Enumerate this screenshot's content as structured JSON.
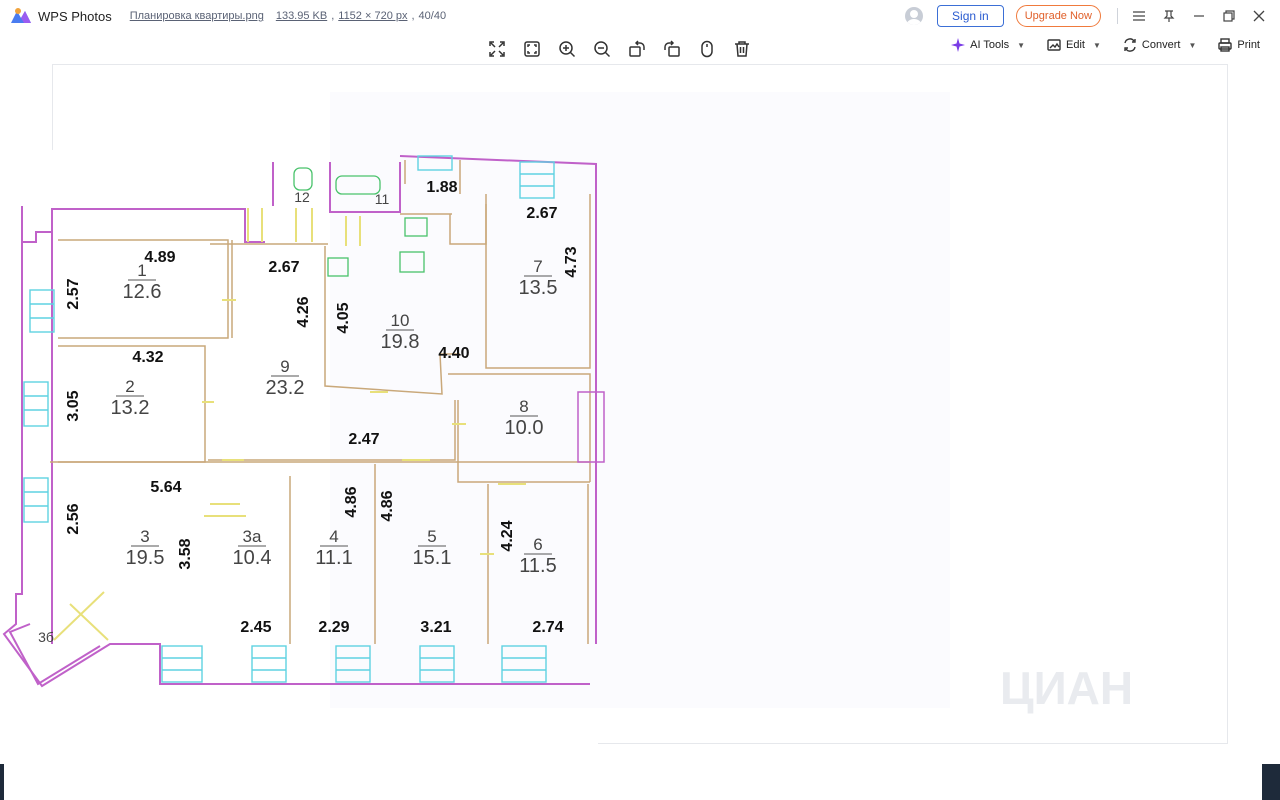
{
  "app": {
    "name": "WPS Photos"
  },
  "file": {
    "name": "Планировка квартиры.png",
    "size": "133.95 KB",
    "dimensions": "1152 × 720 px",
    "index": "40/40"
  },
  "account": {
    "sign_in": "Sign in",
    "upgrade": "Upgrade Now"
  },
  "toolbar": {
    "center_tools": [
      "fit-window-icon",
      "actual-size-icon",
      "zoom-in-icon",
      "zoom-out-icon",
      "rotate-left-icon",
      "rotate-right-icon",
      "mouse-icon",
      "delete-icon"
    ],
    "ai_tools": "AI Tools",
    "edit": "Edit",
    "convert": "Convert",
    "print": "Print"
  },
  "floorplan": {
    "rooms": [
      {
        "id": "1",
        "area": "12.6"
      },
      {
        "id": "2",
        "area": "13.2"
      },
      {
        "id": "3",
        "area": "19.5"
      },
      {
        "id": "3a",
        "area": "10.4"
      },
      {
        "id": "3б",
        "area": ""
      },
      {
        "id": "4",
        "area": "11.1"
      },
      {
        "id": "5",
        "area": "15.1"
      },
      {
        "id": "6",
        "area": "11.5"
      },
      {
        "id": "7",
        "area": "13.5"
      },
      {
        "id": "8",
        "area": "10.0"
      },
      {
        "id": "9",
        "area": "23.2"
      },
      {
        "id": "10",
        "area": "19.8"
      },
      {
        "id": "11",
        "area": ""
      },
      {
        "id": "12",
        "area": ""
      }
    ],
    "dimensions": [
      "4.89",
      "2.57",
      "4.32",
      "3.05",
      "5.64",
      "2.56",
      "3.58",
      "2.45",
      "2.29",
      "4.86",
      "4.86",
      "3.21",
      "2.74",
      "4.24",
      "2.67",
      "4.26",
      "4.05",
      "4.40",
      "2.47",
      "1.88",
      "2.67",
      "4.73"
    ],
    "watermark": "ЦИАН"
  },
  "colors": {
    "wall": "#c061c9",
    "window": "#5fd2e2",
    "door": "#e8e07a",
    "accent": "#3b6fd6",
    "upgrade": "#f07a3c"
  }
}
